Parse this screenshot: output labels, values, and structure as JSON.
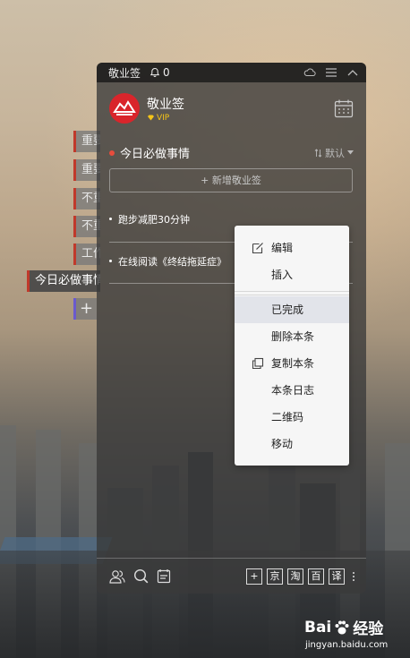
{
  "window": {
    "app_name": "敬业签",
    "notification_count": "0"
  },
  "profile": {
    "name": "敬业签",
    "badge": "VIP"
  },
  "section": {
    "title": "今日必做事情",
    "sort_label": "默认"
  },
  "add_note_label": "+ 新增敬业签",
  "notes": [
    {
      "text": "跑步减肥30分钟"
    },
    {
      "text": "在线阅读《终结拖延症》"
    }
  ],
  "side_tags": [
    {
      "label": "重要"
    },
    {
      "label": "重要"
    },
    {
      "label": "不重"
    },
    {
      "label": "不重"
    },
    {
      "label": "工作"
    },
    {
      "label": "今日必做事情"
    },
    {
      "label": "+"
    }
  ],
  "context_menu": {
    "items": [
      {
        "label": "编辑",
        "icon": "edit-icon"
      },
      {
        "label": "插入",
        "icon": ""
      },
      {
        "label": "已完成",
        "icon": "",
        "highlighted": true
      },
      {
        "label": "删除本条",
        "icon": ""
      },
      {
        "label": "复制本条",
        "icon": "copy-icon"
      },
      {
        "label": "本条日志",
        "icon": ""
      },
      {
        "label": "二维码",
        "icon": ""
      },
      {
        "label": "移动",
        "icon": ""
      }
    ]
  },
  "footer": {
    "quick_buttons": [
      "+",
      "京",
      "淘",
      "百",
      "译"
    ]
  },
  "watermark": {
    "brand_left": "Bai",
    "brand_right": "经验",
    "url": "jingyan.baidu.com"
  },
  "colors": {
    "accent_red": "#d9252b",
    "vip_gold": "#f5c518",
    "menu_highlight": "#e2e4ea"
  }
}
